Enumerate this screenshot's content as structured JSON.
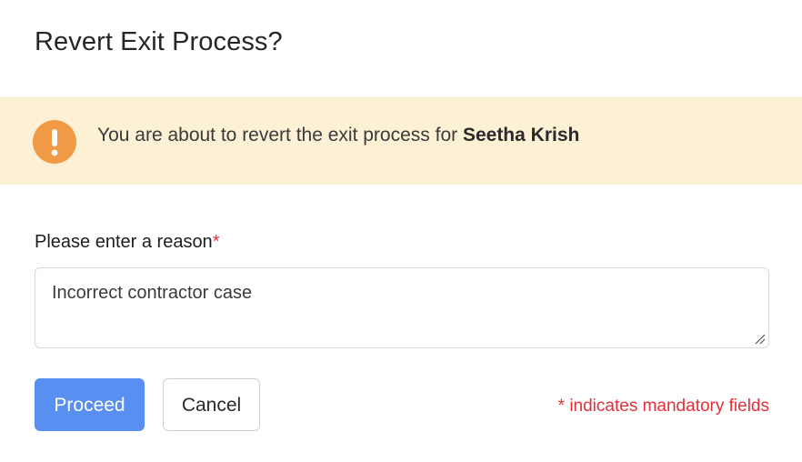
{
  "dialog": {
    "title": "Revert Exit Process?"
  },
  "banner": {
    "icon": "exclamation-icon",
    "icon_color": "#f09a46",
    "background_color": "#fcf1d4",
    "message_prefix": "You are about to revert the exit process for ",
    "employee_name": "Seetha Krish"
  },
  "reason": {
    "label": "Please enter a reason",
    "required_marker": "*",
    "value": "Incorrect contractor case"
  },
  "actions": {
    "proceed_label": "Proceed",
    "cancel_label": "Cancel",
    "primary_color": "#5a8ff2"
  },
  "footer": {
    "mandatory_note": "* indicates mandatory fields",
    "note_color": "#e0303a"
  }
}
